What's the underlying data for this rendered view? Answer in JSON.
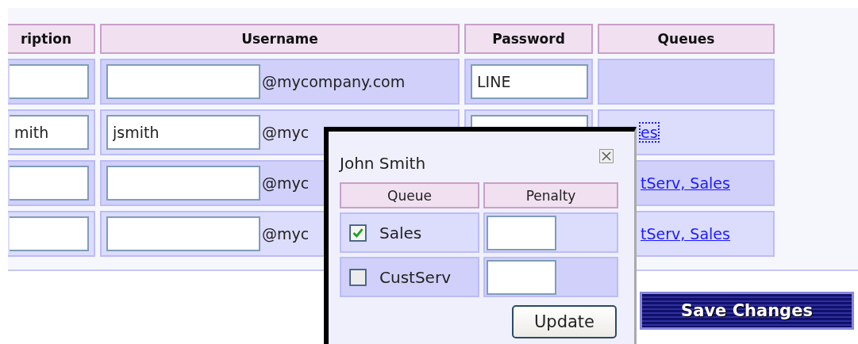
{
  "table": {
    "columns": [
      "ription",
      "Username",
      "Password",
      "Queues"
    ],
    "rows": [
      {
        "domain": "@mycompany.com",
        "password": "LINE"
      },
      {
        "description": "mith",
        "username": "jsmith",
        "domain": "@myc",
        "password_field": true,
        "queues": "es",
        "focused": true
      },
      {
        "domain": "@myc",
        "queues": "tServ, Sales",
        "focused": false
      },
      {
        "domain": "@myc",
        "queues": "tServ, Sales",
        "focused": false
      }
    ]
  },
  "popup": {
    "title": "John Smith",
    "columns": [
      "Queue",
      "Penalty"
    ],
    "rows": [
      {
        "queue": "Sales",
        "checked": true
      },
      {
        "queue": "CustServ",
        "checked": false
      }
    ],
    "button": "Update"
  },
  "save_button": "Save Changes"
}
